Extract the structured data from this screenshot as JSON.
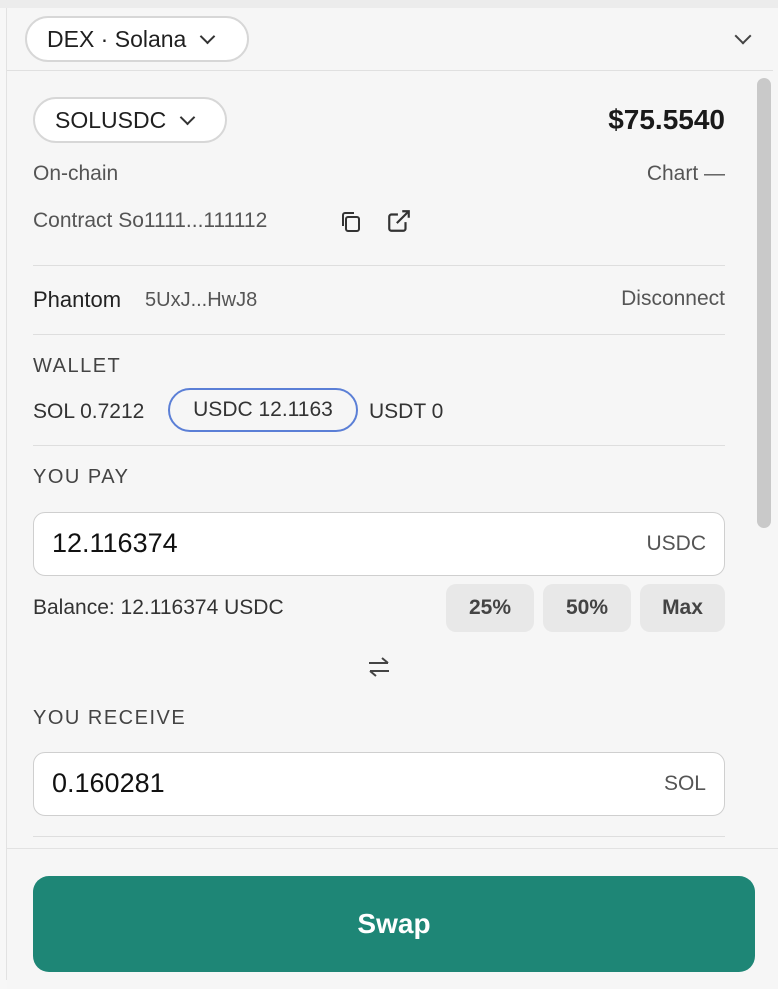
{
  "header": {
    "network_label": "DEX · Solana"
  },
  "market": {
    "pair_label": "SOLUSDC",
    "price": "$75.5540",
    "source": "On-chain",
    "chart_link": "Chart —",
    "contract_label": "Contract So1111...111112"
  },
  "connection": {
    "wallet_name": "Phantom",
    "address": "5UxJ...HwJ8",
    "disconnect_label": "Disconnect"
  },
  "wallet": {
    "title": "WALLET",
    "balances": [
      {
        "label": "SOL 0.7212"
      },
      {
        "label": "USDC 12.1163"
      },
      {
        "label": "USDT 0"
      }
    ]
  },
  "pay": {
    "title": "YOU PAY",
    "amount": "12.116374",
    "unit": "USDC",
    "balance_text": "Balance: 12.116374 USDC",
    "presets": [
      "25%",
      "50%",
      "Max"
    ]
  },
  "receive": {
    "title": "YOU RECEIVE",
    "amount": "0.160281",
    "unit": "SOL"
  },
  "action": {
    "swap_label": "Swap"
  }
}
